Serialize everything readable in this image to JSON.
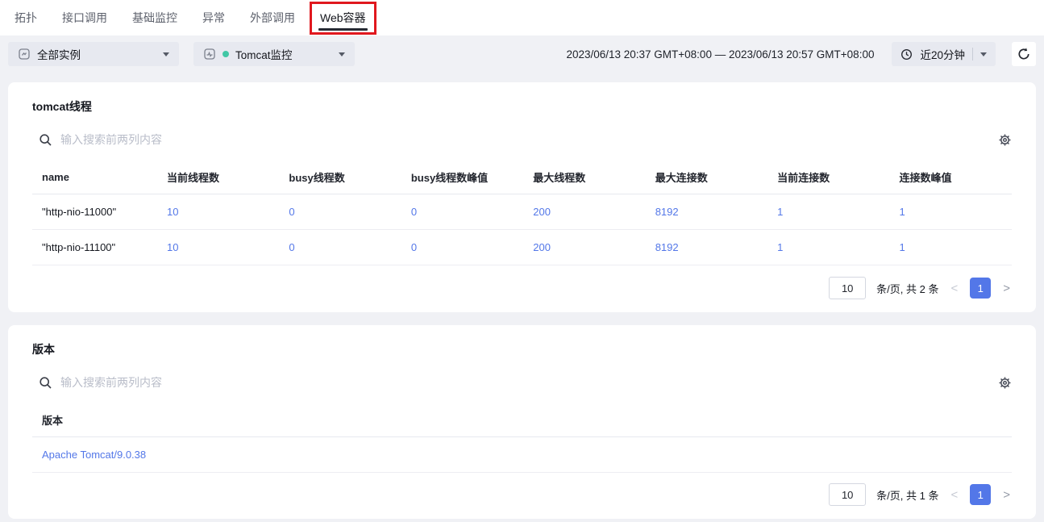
{
  "tabs": {
    "items": [
      {
        "label": "拓扑"
      },
      {
        "label": "接口调用"
      },
      {
        "label": "基础监控"
      },
      {
        "label": "异常"
      },
      {
        "label": "外部调用"
      },
      {
        "label": "Web容器"
      }
    ],
    "active": "Web容器"
  },
  "toolbar": {
    "instance_dropdown": {
      "value": "全部实例"
    },
    "monitor_dropdown": {
      "value": "Tomcat监控"
    },
    "time_range": "2023/06/13 20:37 GMT+08:00 — 2023/06/13 20:57 GMT+08:00",
    "time_preset": "近20分钟"
  },
  "thread_card": {
    "title": "tomcat线程",
    "search_placeholder": "输入搜索前两列内容",
    "columns": [
      "name",
      "当前线程数",
      "busy线程数",
      "busy线程数峰值",
      "最大线程数",
      "最大连接数",
      "当前连接数",
      "连接数峰值"
    ],
    "rows": [
      [
        "\"http-nio-11000\"",
        "10",
        "0",
        "0",
        "200",
        "8192",
        "1",
        "1"
      ],
      [
        "\"http-nio-11100\"",
        "10",
        "0",
        "0",
        "200",
        "8192",
        "1",
        "1"
      ]
    ],
    "pagination": {
      "page_size": "10",
      "summary": "条/页, 共 2 条",
      "page": "1",
      "prev": "<",
      "next": ">"
    }
  },
  "version_card": {
    "title": "版本",
    "search_placeholder": "输入搜索前两列内容",
    "columns": [
      "版本"
    ],
    "rows": [
      [
        "Apache Tomcat/9.0.38"
      ]
    ],
    "pagination": {
      "page_size": "10",
      "summary": "条/页, 共 1 条",
      "page": "1",
      "prev": "<",
      "next": ">"
    }
  },
  "colors": {
    "accent_blue": "#5377e8",
    "annotation_red": "#e0181e",
    "status_green": "#41c7a5"
  }
}
